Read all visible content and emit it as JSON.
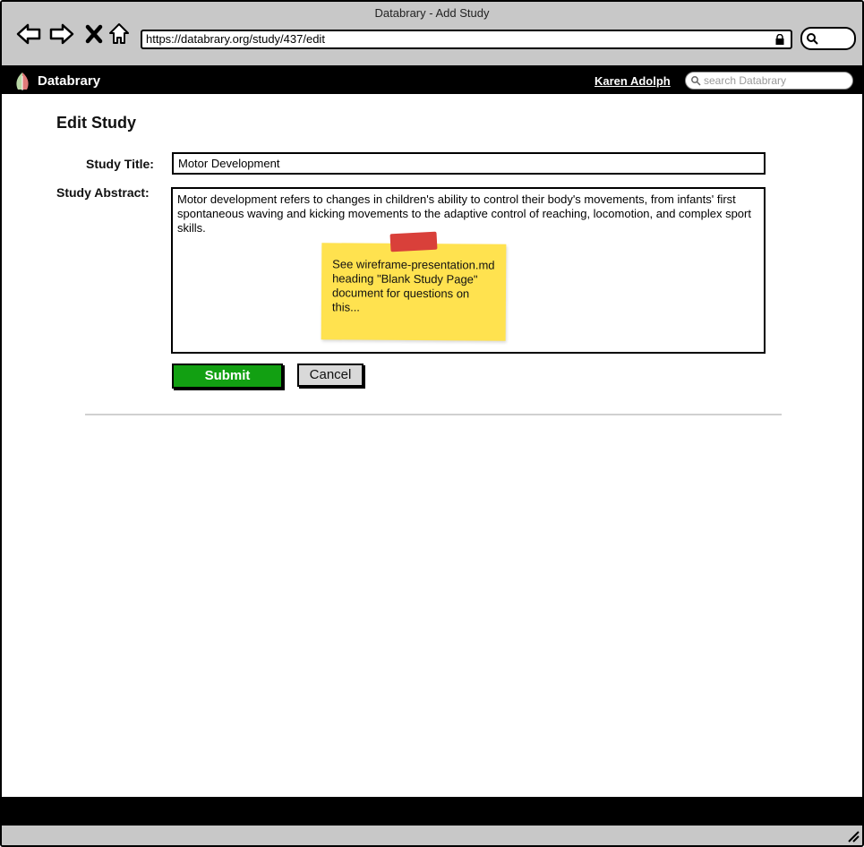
{
  "browser": {
    "window_title": "Databrary - Add Study",
    "url": "https://databrary.org/study/437/edit"
  },
  "topbar": {
    "brand": "Databrary",
    "user_name": "Karen Adolph",
    "search_placeholder": "search Databrary"
  },
  "form": {
    "heading": "Edit Study",
    "title_label": "Study Title:",
    "title_value": "Motor Development",
    "abstract_label": "Study Abstract:",
    "abstract_value": "Motor development refers to changes in children's ability to control their body's movements, from infants' first spontaneous waving and kicking movements to the adaptive control of reaching, locomotion, and complex sport skills.",
    "submit_label": "Submit",
    "cancel_label": "Cancel"
  },
  "sticky_note": {
    "text": "See wireframe-presentation.md heading \"Blank Study Page\" document for questions on this..."
  },
  "colors": {
    "submit": "#12a012",
    "note": "#ffe24f",
    "tape": "#d9403a",
    "topbar": "#000000"
  },
  "icons": [
    "back-icon",
    "forward-icon",
    "stop-icon",
    "home-icon",
    "lock-icon",
    "search-icon",
    "logo-icon",
    "resize-grip-icon"
  ]
}
